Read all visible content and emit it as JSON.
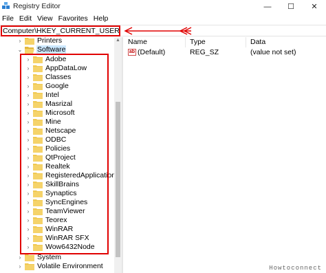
{
  "window": {
    "title": "Registry Editor",
    "controls": {
      "minimize": "—",
      "maximize": "☐",
      "close": "✕"
    }
  },
  "menu": [
    "File",
    "Edit",
    "View",
    "Favorites",
    "Help"
  ],
  "address": {
    "path": "Computer\\HKEY_CURRENT_USER\\Software"
  },
  "tree": {
    "top_items": [
      {
        "label": "Printers",
        "has_children": true
      },
      {
        "label": "Software",
        "has_children": true,
        "expanded": true,
        "selected": true
      }
    ],
    "software_children": [
      "Adobe",
      "AppDataLow",
      "Classes",
      "Google",
      "Intel",
      "Masrizal",
      "Microsoft",
      "Mine",
      "Netscape",
      "ODBC",
      "Policies",
      "QtProject",
      "Realtek",
      "RegisteredApplications",
      "SkillBrains",
      "Synaptics",
      "SyncEngines",
      "TeamViewer",
      "Teorex",
      "WinRAR",
      "WinRAR SFX",
      "Wow6432Node"
    ],
    "bottom_items": [
      {
        "label": "System",
        "has_children": true
      },
      {
        "label": "Volatile Environment",
        "has_children": true
      }
    ]
  },
  "values_pane": {
    "columns": [
      "Name",
      "Type",
      "Data"
    ],
    "rows": [
      {
        "icon": "ab",
        "name": "(Default)",
        "type": "REG_SZ",
        "data": "(value not set)"
      }
    ]
  },
  "watermark": "Howtoconnect",
  "colors": {
    "highlight": "#e00000",
    "folder": "#f0c850",
    "selection": "#cce8ff"
  }
}
